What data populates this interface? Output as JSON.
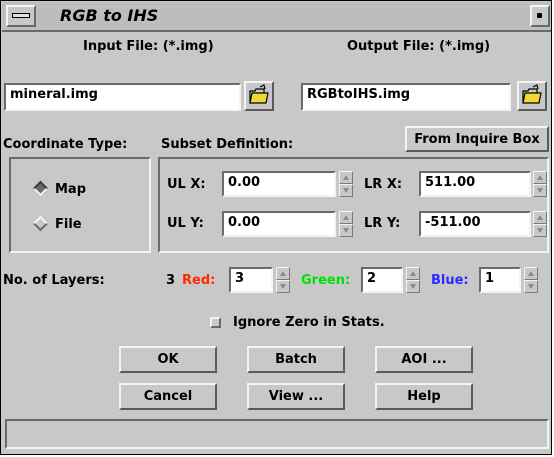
{
  "window": {
    "title": "RGB to IHS"
  },
  "io": {
    "input_label": "Input File: (*.img)",
    "input_value": "mineral.img",
    "output_label": "Output File: (*.img)",
    "output_value": "RGBtoIHS.img"
  },
  "coords": {
    "label": "Coordinate Type:",
    "options": [
      {
        "label": "Map",
        "selected": true
      },
      {
        "label": "File",
        "selected": false
      }
    ]
  },
  "subset": {
    "label": "Subset Definition:",
    "inquire_button": "From Inquire Box",
    "ulx_label": "UL X:",
    "ulx_value": "0.00",
    "lrx_label": "LR X:",
    "lrx_value": "511.00",
    "uly_label": "UL Y:",
    "uly_value": "0.00",
    "lry_label": "LR Y:",
    "lry_value": "-511.00"
  },
  "layers": {
    "label": "No. of Layers:",
    "count": "3",
    "red_label": "Red:",
    "red_value": "3",
    "green_label": "Green:",
    "green_value": "2",
    "blue_label": "Blue:",
    "blue_value": "1",
    "colors": {
      "red": "#ff2a00",
      "green": "#00e000",
      "blue": "#2a2aff"
    }
  },
  "ignore_zero": {
    "label": "Ignore Zero in Stats.",
    "checked": false
  },
  "buttons": {
    "ok": "OK",
    "batch": "Batch",
    "aoi": "AOI ...",
    "cancel": "Cancel",
    "view": "View ...",
    "help": "Help"
  },
  "icons": {
    "window_menu": "window-menu-icon",
    "folder": "open-folder-icon",
    "spinner": "spinner-arrows-icon"
  },
  "status": {
    "text": ""
  }
}
